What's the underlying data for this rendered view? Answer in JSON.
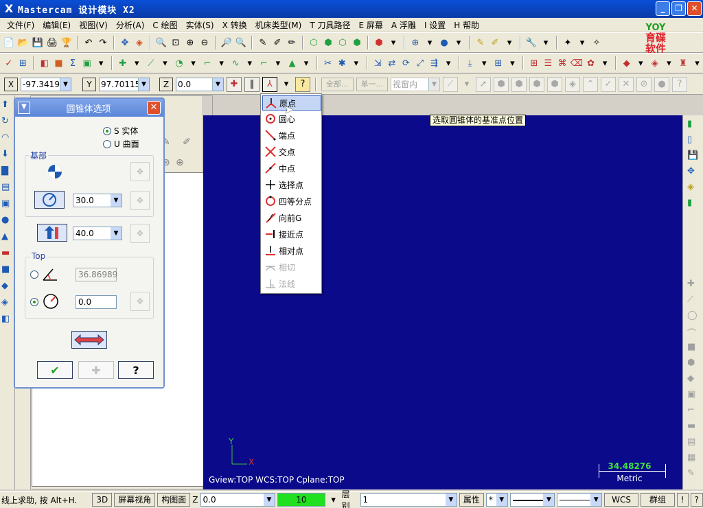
{
  "window": {
    "title": "Mastercam 设计模块  X2",
    "app_icon": "X"
  },
  "menu": [
    "文件(F)",
    "编辑(E)",
    "视图(V)",
    "分析(A)",
    "C 绘图",
    "实体(S)",
    "X 转换",
    "机床类型(M)",
    "T 刀具路径",
    "E 屏幕",
    "A 浮雕",
    "I 设置",
    "H 帮助"
  ],
  "logo": {
    "top": "YOY",
    "line1": "育碟",
    "line2": "软件"
  },
  "ribbon": {
    "x_label": "X",
    "x_value": "-97.34195",
    "y_label": "Y",
    "y_value": "97.70115",
    "z_label": "Z",
    "z_value": "0.0",
    "btn_all": "全部...",
    "btn_single": "单一...",
    "btn_view": "视窗内"
  },
  "dialog": {
    "title": "圆锥体选项",
    "opt_solid": "S 实体",
    "opt_surface": "U 曲面",
    "group_base": "基部",
    "base_radius": "30.0",
    "height": "40.0",
    "group_top": "Top",
    "top_angle": "36.86989",
    "top_radius": "0.0"
  },
  "dropdown": {
    "items": [
      {
        "label": "原点",
        "icon": "origin-point-icon",
        "selected": true,
        "enabled": true
      },
      {
        "label": "圆心",
        "icon": "arc-center-icon",
        "selected": false,
        "enabled": true
      },
      {
        "label": "端点",
        "icon": "endpoint-icon",
        "selected": false,
        "enabled": true
      },
      {
        "label": "交点",
        "icon": "intersection-icon",
        "selected": false,
        "enabled": true
      },
      {
        "label": "中点",
        "icon": "midpoint-icon",
        "selected": false,
        "enabled": true
      },
      {
        "label": "选择点",
        "icon": "point-icon",
        "selected": false,
        "enabled": true
      },
      {
        "label": "四等分点",
        "icon": "quadrant-icon",
        "selected": false,
        "enabled": true
      },
      {
        "label": "向前G",
        "icon": "nearest-icon",
        "selected": false,
        "enabled": true
      },
      {
        "label": "接近点",
        "icon": "relative-icon",
        "selected": false,
        "enabled": true
      },
      {
        "label": "相对点",
        "icon": "relative-point-icon",
        "selected": false,
        "enabled": true
      },
      {
        "label": "相切",
        "icon": "tangent-icon",
        "selected": false,
        "enabled": false
      },
      {
        "label": "法线",
        "icon": "perpendicular-icon",
        "selected": false,
        "enabled": false
      }
    ]
  },
  "viewport": {
    "tooltip": "选取圆锥体的基准点位置",
    "axis_y": "Y",
    "axis_x": "X",
    "info": "Gview:TOP   WCS:TOP   Cplane:TOP",
    "scale_value": "34.48276",
    "scale_unit": "Metric",
    "background": "#0a0a8a"
  },
  "status": {
    "help": "线上求助, 按 Alt+H.",
    "btn_3d": "3D",
    "btn_screen_view": "屏幕视角",
    "btn_plane": "构图面",
    "z_label": "Z",
    "z_value": "0.0",
    "color_value": "10",
    "layer_label": "层别",
    "layer_value": "1",
    "btn_attributes": "属性",
    "btn_wcs": "WCS",
    "btn_group": "群组",
    "btn_help": "!",
    "btn_question": "?"
  }
}
